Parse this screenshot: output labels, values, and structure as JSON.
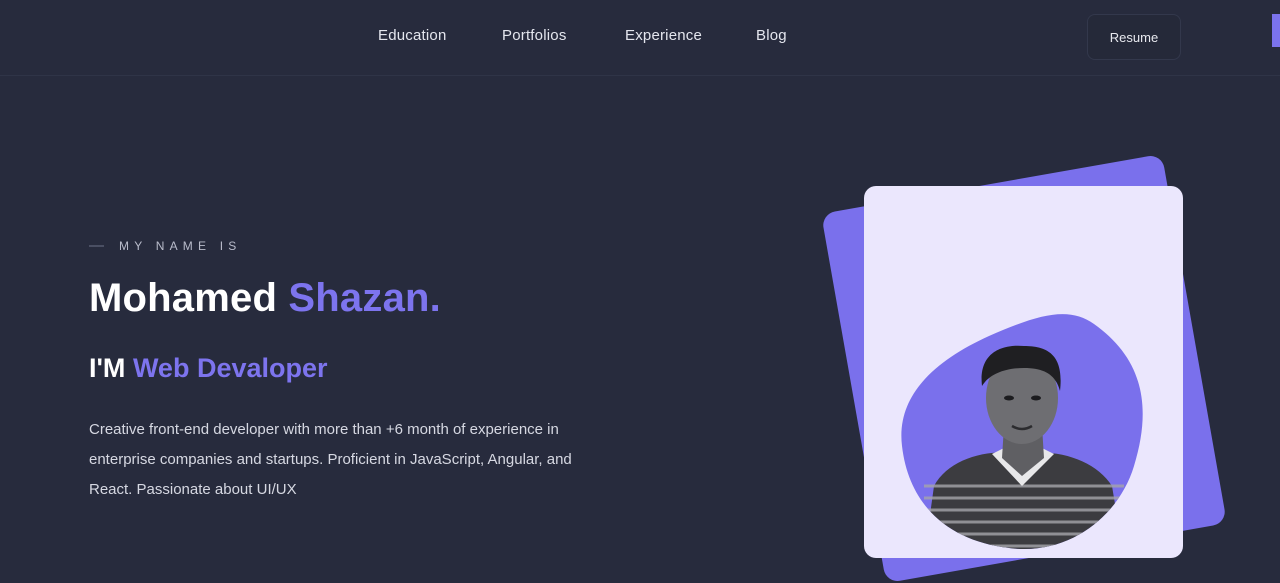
{
  "nav": {
    "links": [
      "Education",
      "Portfolios",
      "Experience",
      "Blog"
    ],
    "resume_label": "Resume"
  },
  "hero": {
    "eyebrow": "MY NAME IS",
    "first_name": "Mohamed",
    "last_name": "Shazan.",
    "role_prefix": "I'M",
    "role_title": "Web Devaloper",
    "bio": "Creative front-end developer with more than +6 month of experience in enterprise companies and startups. Proficient in JavaScript, Angular, and React. Passionate about UI/UX"
  },
  "colors": {
    "background": "#272b3d",
    "accent": "#7d74ee",
    "card": "#ebe7fd"
  }
}
